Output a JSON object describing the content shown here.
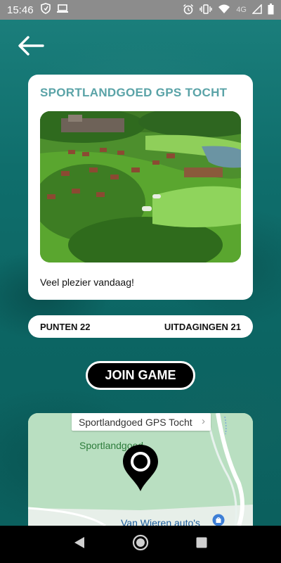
{
  "status_bar": {
    "time": "15:46",
    "network": "4G",
    "icons_left": [
      "shield-icon",
      "laptop-icon"
    ],
    "icons_right": [
      "alarm-icon",
      "vibrate-icon",
      "wifi-icon",
      "signal-icon",
      "battery-icon"
    ]
  },
  "card": {
    "title": "SPORTLANDGOED GPS TOCHT",
    "description": "Veel plezier vandaag!"
  },
  "stats": {
    "points": "PUNTEN 22",
    "challenges": "UITDAGINGEN 21"
  },
  "join_button": "JOIN GAME",
  "map": {
    "callout": "Sportlandgoed GPS Tocht",
    "place_label": "Sportlandgoed",
    "poi_label": "Van Wieren auto's"
  },
  "colors": {
    "accent_title": "#5aa3a7",
    "background": "#0f6d6c",
    "map_green": "#b9dfc1"
  }
}
